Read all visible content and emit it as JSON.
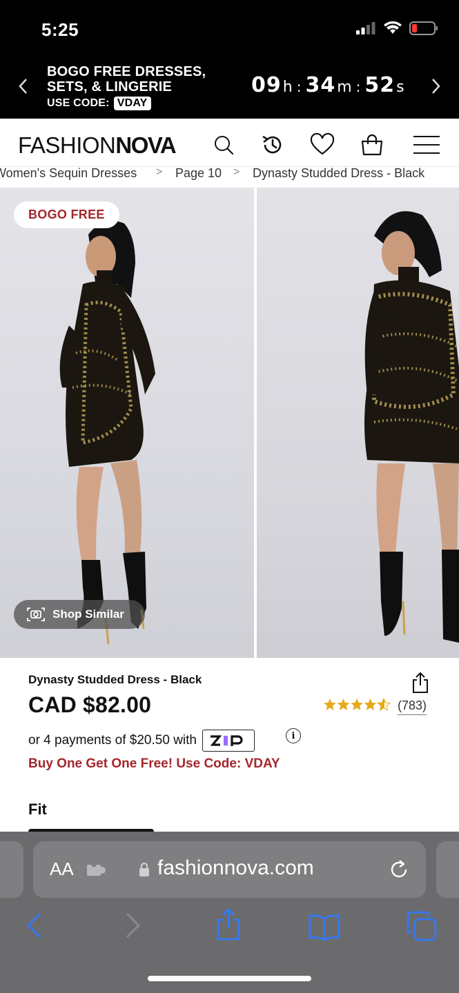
{
  "status_bar": {
    "time": "5:25"
  },
  "promo_banner": {
    "line1": "BOGO FREE DRESSES,",
    "line2": "SETS, & LINGERIE",
    "code_label": "USE CODE:",
    "code": "VDAY",
    "timer": {
      "hours": "09",
      "h": "h",
      "minutes": "34",
      "m": "m",
      "seconds": "52",
      "s": "s",
      "sep": ":"
    }
  },
  "header": {
    "logo_light": "FASHION",
    "logo_bold": "NOVA"
  },
  "breadcrumb": {
    "items": [
      "Women's Sequin Dresses",
      "Page 10",
      "Dynasty Studded Dress - Black"
    ],
    "separator": ">"
  },
  "gallery": {
    "badge": "BOGO FREE",
    "shop_similar": "Shop Similar"
  },
  "product": {
    "title": "Dynasty Studded Dress - Black",
    "price": "CAD $82.00",
    "rating_stars": 4.5,
    "review_count": "(783)",
    "installments_text": "or 4 payments of $20.50 with",
    "zip_label": "Zip",
    "promo_text": "Buy One Get One Free! Use Code: VDAY",
    "fit_label": "Fit"
  },
  "browser": {
    "aa": "AA",
    "url": "fashionnova.com"
  },
  "colors": {
    "accent_red": "#a4262c",
    "star": "#e5a91a",
    "browser_bg": "#6b6b6d",
    "ios_blue": "#3478f6"
  }
}
